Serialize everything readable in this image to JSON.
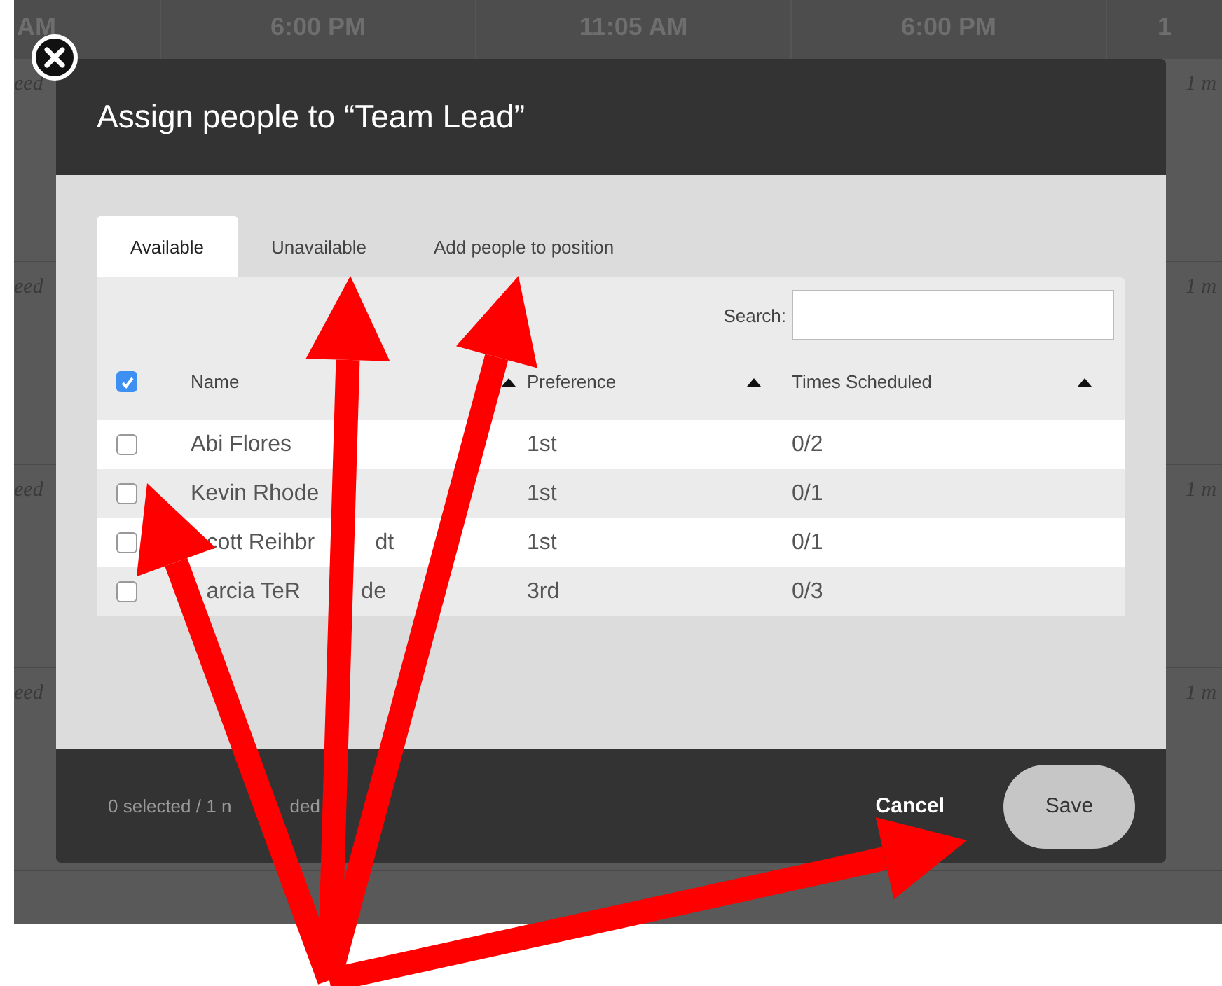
{
  "background": {
    "header_cells": [
      "AM",
      "6:00 PM",
      "11:05 AM",
      "6:00 PM",
      "1"
    ],
    "rows": [
      {
        "left": "eed",
        "right": "1 m"
      },
      {
        "left": "eed",
        "right": "1 m"
      },
      {
        "left": "eed",
        "right": "1 m"
      },
      {
        "left": "eed",
        "right": "1 m"
      }
    ]
  },
  "dialog": {
    "title": "Assign people to “Team Lead”",
    "tabs": [
      {
        "label": "Available",
        "selected": true
      },
      {
        "label": "Unavailable",
        "selected": false
      },
      {
        "label": "Add people to position",
        "selected": false
      }
    ],
    "search": {
      "label": "Search:"
    },
    "select_all_checked": true,
    "columns": [
      "Name",
      "Preference",
      "Times Scheduled"
    ],
    "rows": [
      {
        "name_parts": [
          "Abi Flores"
        ],
        "lead_hidden": false,
        "preference": "1st",
        "times": "0/2",
        "checked": false
      },
      {
        "name_parts": [
          "Kevin Rhode"
        ],
        "lead_hidden": false,
        "preference": "1st",
        "times": "0/1",
        "checked": false
      },
      {
        "name_parts": [
          "cott Reihbr",
          "dt"
        ],
        "lead_hidden": true,
        "preference": "1st",
        "times": "0/1",
        "checked": false
      },
      {
        "name_parts": [
          "arcia TeR",
          "de"
        ],
        "lead_hidden": true,
        "preference": "3rd",
        "times": "0/3",
        "checked": false
      }
    ],
    "status_parts": [
      "0 selected / 1 n",
      "ded"
    ],
    "buttons": [
      {
        "label": "Cancel",
        "kind": "text"
      },
      {
        "label": "Save",
        "kind": "pill"
      }
    ]
  }
}
